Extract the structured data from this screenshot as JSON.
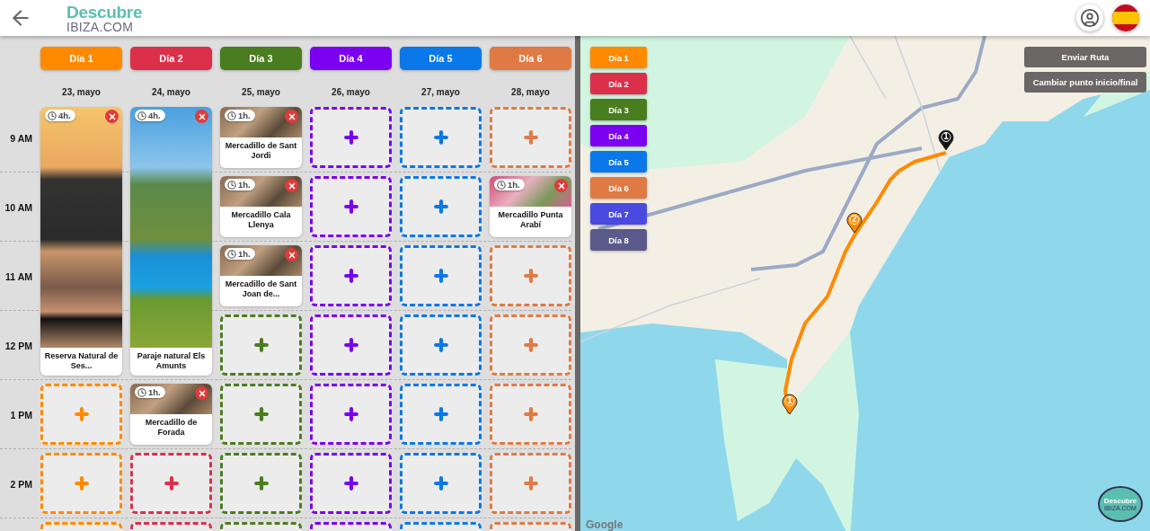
{
  "header": {
    "logo_top": "Descubre",
    "logo_bottom": "IBIZA.COM"
  },
  "hours": [
    "9 AM",
    "10 AM",
    "11 AM",
    "12 PM",
    "1 PM",
    "2 PM"
  ],
  "days": [
    {
      "label": "Día 1",
      "color": "#ff8a00",
      "date": "23, mayo",
      "slots": [
        {
          "kind": "tall",
          "duration": "4h.",
          "title": "Reserva Natural de Ses..."
        },
        {
          "kind": "empty"
        },
        {
          "kind": "empty"
        },
        {
          "kind": "empty"
        }
      ]
    },
    {
      "label": "Día 2",
      "color": "#dc2f4a",
      "date": "24, mayo",
      "slots": [
        {
          "kind": "tall",
          "duration": "4h.",
          "title": "Paraje natural Els Amunts"
        },
        {
          "kind": "short",
          "duration": "1h.",
          "title": "Mercadillo de Forada"
        },
        {
          "kind": "empty"
        },
        {
          "kind": "empty"
        }
      ]
    },
    {
      "label": "Día 3",
      "color": "#4a7c20",
      "date": "25, mayo",
      "slots": [
        {
          "kind": "short",
          "duration": "1h.",
          "title": "Mercadillo de Sant Jordi"
        },
        {
          "kind": "short",
          "duration": "1h.",
          "title": "Mercadillo Cala Llenya"
        },
        {
          "kind": "short",
          "duration": "1h.",
          "title": "Mercadillo de Sant Joan de..."
        },
        {
          "kind": "empty"
        },
        {
          "kind": "empty"
        },
        {
          "kind": "empty"
        },
        {
          "kind": "empty"
        }
      ]
    },
    {
      "label": "Día 4",
      "color": "#7b00f0",
      "date": "26, mayo",
      "slots": [
        {
          "kind": "empty"
        },
        {
          "kind": "empty"
        },
        {
          "kind": "empty"
        },
        {
          "kind": "empty"
        },
        {
          "kind": "empty"
        },
        {
          "kind": "empty"
        },
        {
          "kind": "empty"
        }
      ]
    },
    {
      "label": "Día 5",
      "color": "#0a78e8",
      "date": "27, mayo",
      "slots": [
        {
          "kind": "empty"
        },
        {
          "kind": "empty"
        },
        {
          "kind": "empty"
        },
        {
          "kind": "empty"
        },
        {
          "kind": "empty"
        },
        {
          "kind": "empty"
        },
        {
          "kind": "empty"
        }
      ]
    },
    {
      "label": "Día 6",
      "color": "#e07a45",
      "date": "28, mayo",
      "slots": [
        {
          "kind": "empty"
        },
        {
          "kind": "short",
          "duration": "1h.",
          "title": "Mercadillo Punta Arabí"
        },
        {
          "kind": "empty"
        },
        {
          "kind": "empty"
        },
        {
          "kind": "empty"
        },
        {
          "kind": "empty"
        },
        {
          "kind": "empty"
        }
      ]
    }
  ],
  "map": {
    "legend": [
      {
        "label": "Día 1",
        "color": "#ff8a00"
      },
      {
        "label": "Día 2",
        "color": "#dc2f4a"
      },
      {
        "label": "Día 3",
        "color": "#4a7c20"
      },
      {
        "label": "Día 4",
        "color": "#7b00f0"
      },
      {
        "label": "Día 5",
        "color": "#0a78e8"
      },
      {
        "label": "Día 6",
        "color": "#e07a45"
      },
      {
        "label": "Día 7",
        "color": "#4a4ae0"
      },
      {
        "label": "Día 8",
        "color": "#5a5a8a"
      }
    ],
    "buttons": [
      "Enviar Ruta",
      "Cambiar punto inicio/final"
    ],
    "pins": [
      {
        "number": "1",
        "color": "#111111"
      },
      {
        "number": "2",
        "color": "#ff8a00"
      },
      {
        "number": "1",
        "color": "#ff8a00"
      }
    ],
    "attribution": "Google",
    "chat_logo": {
      "top": "Descubre",
      "bottom": "IBIZA.COM"
    }
  }
}
